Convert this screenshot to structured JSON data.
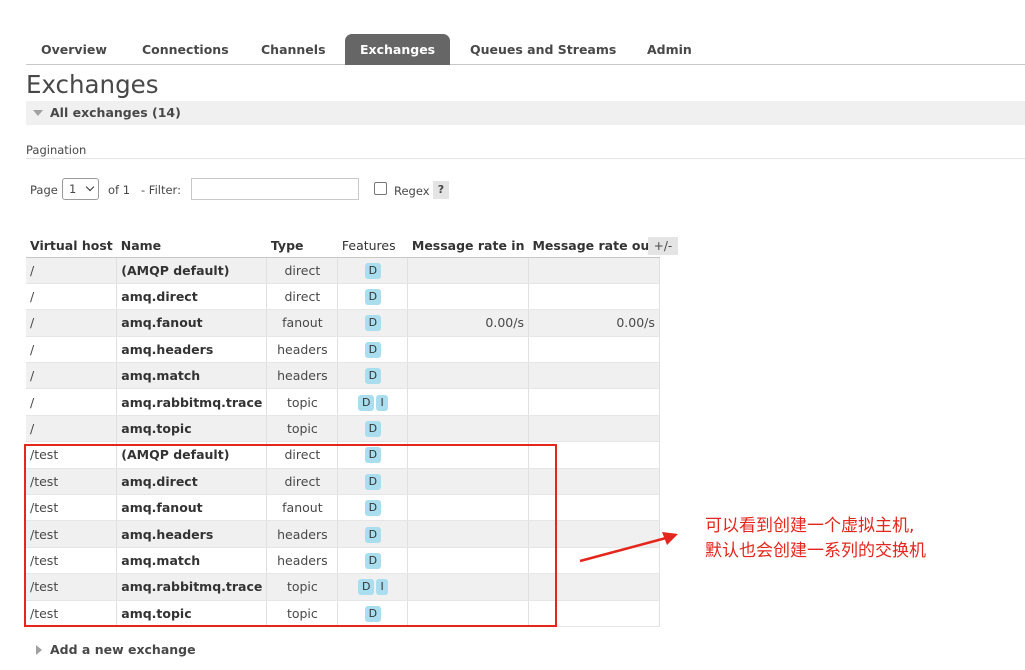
{
  "tabs": [
    {
      "label": "Overview",
      "active": false
    },
    {
      "label": "Connections",
      "active": false
    },
    {
      "label": "Channels",
      "active": false
    },
    {
      "label": "Exchanges",
      "active": true
    },
    {
      "label": "Queues and Streams",
      "active": false
    },
    {
      "label": "Admin",
      "active": false
    }
  ],
  "page_title": "Exchanges",
  "section_label": "All exchanges (14)",
  "pagination": {
    "label": "Pagination",
    "page_label": "Page",
    "page_value": "1",
    "of_label": "of 1",
    "filter_label": "- Filter:",
    "filter_value": "",
    "regex_label": "Regex",
    "regex_checked": false,
    "help_label": "?"
  },
  "table": {
    "columns": [
      "Virtual host",
      "Name",
      "Type",
      "Features",
      "Message rate in",
      "Message rate out"
    ],
    "toggle_columns_label": "+/-",
    "rows": [
      {
        "vhost": "/",
        "name": "(AMQP default)",
        "type": "direct",
        "features": [
          "D"
        ],
        "rate_in": "",
        "rate_out": ""
      },
      {
        "vhost": "/",
        "name": "amq.direct",
        "type": "direct",
        "features": [
          "D"
        ],
        "rate_in": "",
        "rate_out": ""
      },
      {
        "vhost": "/",
        "name": "amq.fanout",
        "type": "fanout",
        "features": [
          "D"
        ],
        "rate_in": "0.00/s",
        "rate_out": "0.00/s"
      },
      {
        "vhost": "/",
        "name": "amq.headers",
        "type": "headers",
        "features": [
          "D"
        ],
        "rate_in": "",
        "rate_out": ""
      },
      {
        "vhost": "/",
        "name": "amq.match",
        "type": "headers",
        "features": [
          "D"
        ],
        "rate_in": "",
        "rate_out": ""
      },
      {
        "vhost": "/",
        "name": "amq.rabbitmq.trace",
        "type": "topic",
        "features": [
          "D",
          "I"
        ],
        "rate_in": "",
        "rate_out": ""
      },
      {
        "vhost": "/",
        "name": "amq.topic",
        "type": "topic",
        "features": [
          "D"
        ],
        "rate_in": "",
        "rate_out": ""
      },
      {
        "vhost": "/test",
        "name": "(AMQP default)",
        "type": "direct",
        "features": [
          "D"
        ],
        "rate_in": "",
        "rate_out": ""
      },
      {
        "vhost": "/test",
        "name": "amq.direct",
        "type": "direct",
        "features": [
          "D"
        ],
        "rate_in": "",
        "rate_out": ""
      },
      {
        "vhost": "/test",
        "name": "amq.fanout",
        "type": "fanout",
        "features": [
          "D"
        ],
        "rate_in": "",
        "rate_out": ""
      },
      {
        "vhost": "/test",
        "name": "amq.headers",
        "type": "headers",
        "features": [
          "D"
        ],
        "rate_in": "",
        "rate_out": ""
      },
      {
        "vhost": "/test",
        "name": "amq.match",
        "type": "headers",
        "features": [
          "D"
        ],
        "rate_in": "",
        "rate_out": ""
      },
      {
        "vhost": "/test",
        "name": "amq.rabbitmq.trace",
        "type": "topic",
        "features": [
          "D",
          "I"
        ],
        "rate_in": "",
        "rate_out": ""
      },
      {
        "vhost": "/test",
        "name": "amq.topic",
        "type": "topic",
        "features": [
          "D"
        ],
        "rate_in": "",
        "rate_out": ""
      }
    ]
  },
  "annotation": {
    "line1": "可以看到创建一个虚拟主机,",
    "line2": "默认也会创建一系列的交换机",
    "color": "#e5261c"
  },
  "add_exchange_label": "Add a new exchange",
  "colors": {
    "active_tab_bg": "#666666",
    "badge_bg": "#aaddee",
    "row_alt_bg": "#f0f0f0"
  }
}
